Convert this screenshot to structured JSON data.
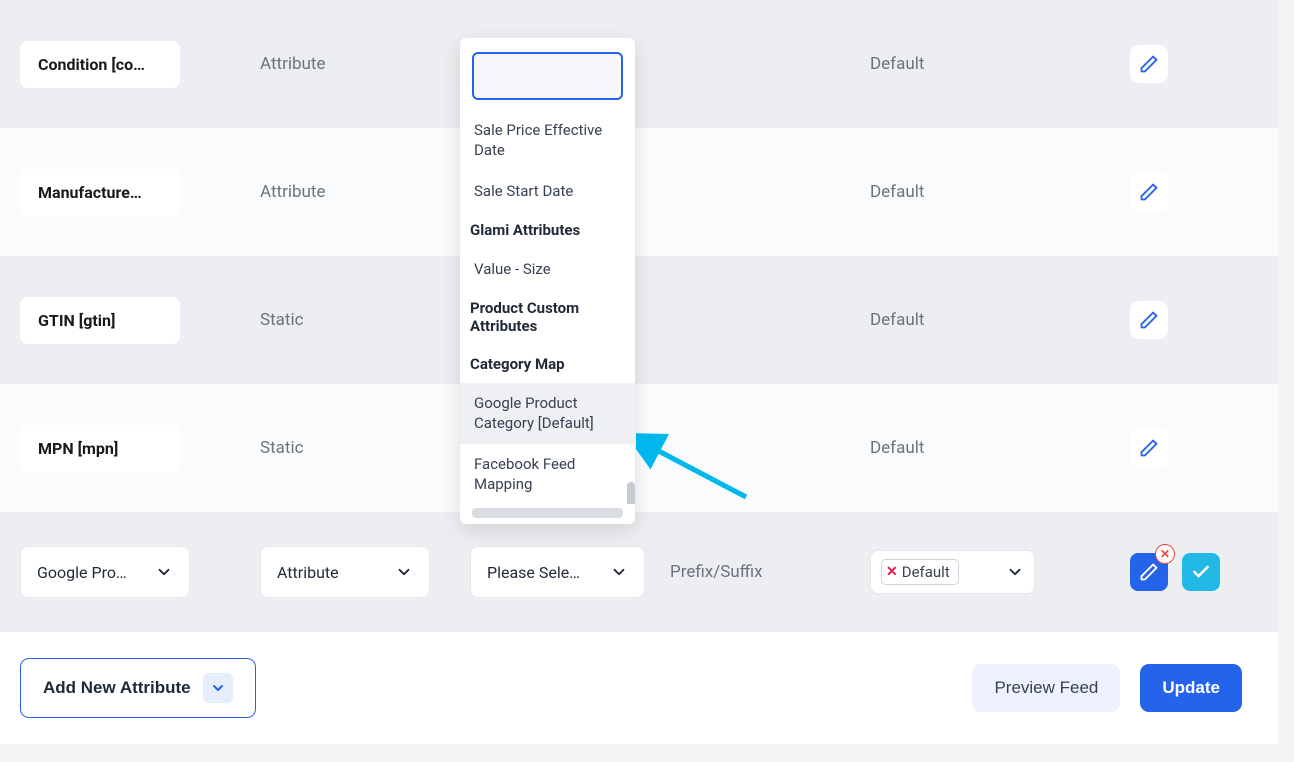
{
  "rows": [
    {
      "label": "Condition [co…",
      "type": "Attribute",
      "value": "",
      "output": "Default"
    },
    {
      "label": "Manufacture…",
      "type": "Attribute",
      "value": "",
      "output": "Default"
    },
    {
      "label": "GTIN [gtin]",
      "type": "Static",
      "value": "",
      "output": "Default"
    },
    {
      "label": "MPN [mpn]",
      "type": "Static",
      "value": "",
      "output": "Default"
    }
  ],
  "row5": {
    "attr_select": "Google Pro…",
    "type_select": "Attribute",
    "value_select": "Please Sele…",
    "prefix_label": "Prefix/Suffix",
    "output_pill": "Default"
  },
  "dropdown": {
    "items": [
      {
        "text": "Sale Price Effective Date",
        "type": "item"
      },
      {
        "text": "Sale Start Date",
        "type": "item"
      },
      {
        "text": "Glami Attributes",
        "type": "header"
      },
      {
        "text": "Value - Size",
        "type": "item"
      },
      {
        "text": "Product Custom Attributes",
        "type": "header"
      },
      {
        "text": "Category Map",
        "type": "header"
      },
      {
        "text": "Google Product Category [Default]",
        "type": "item",
        "hovered": true
      },
      {
        "text": "Facebook Feed Mapping",
        "type": "item"
      }
    ]
  },
  "footer": {
    "add": "Add New Attribute",
    "preview": "Preview Feed",
    "update": "Update"
  }
}
